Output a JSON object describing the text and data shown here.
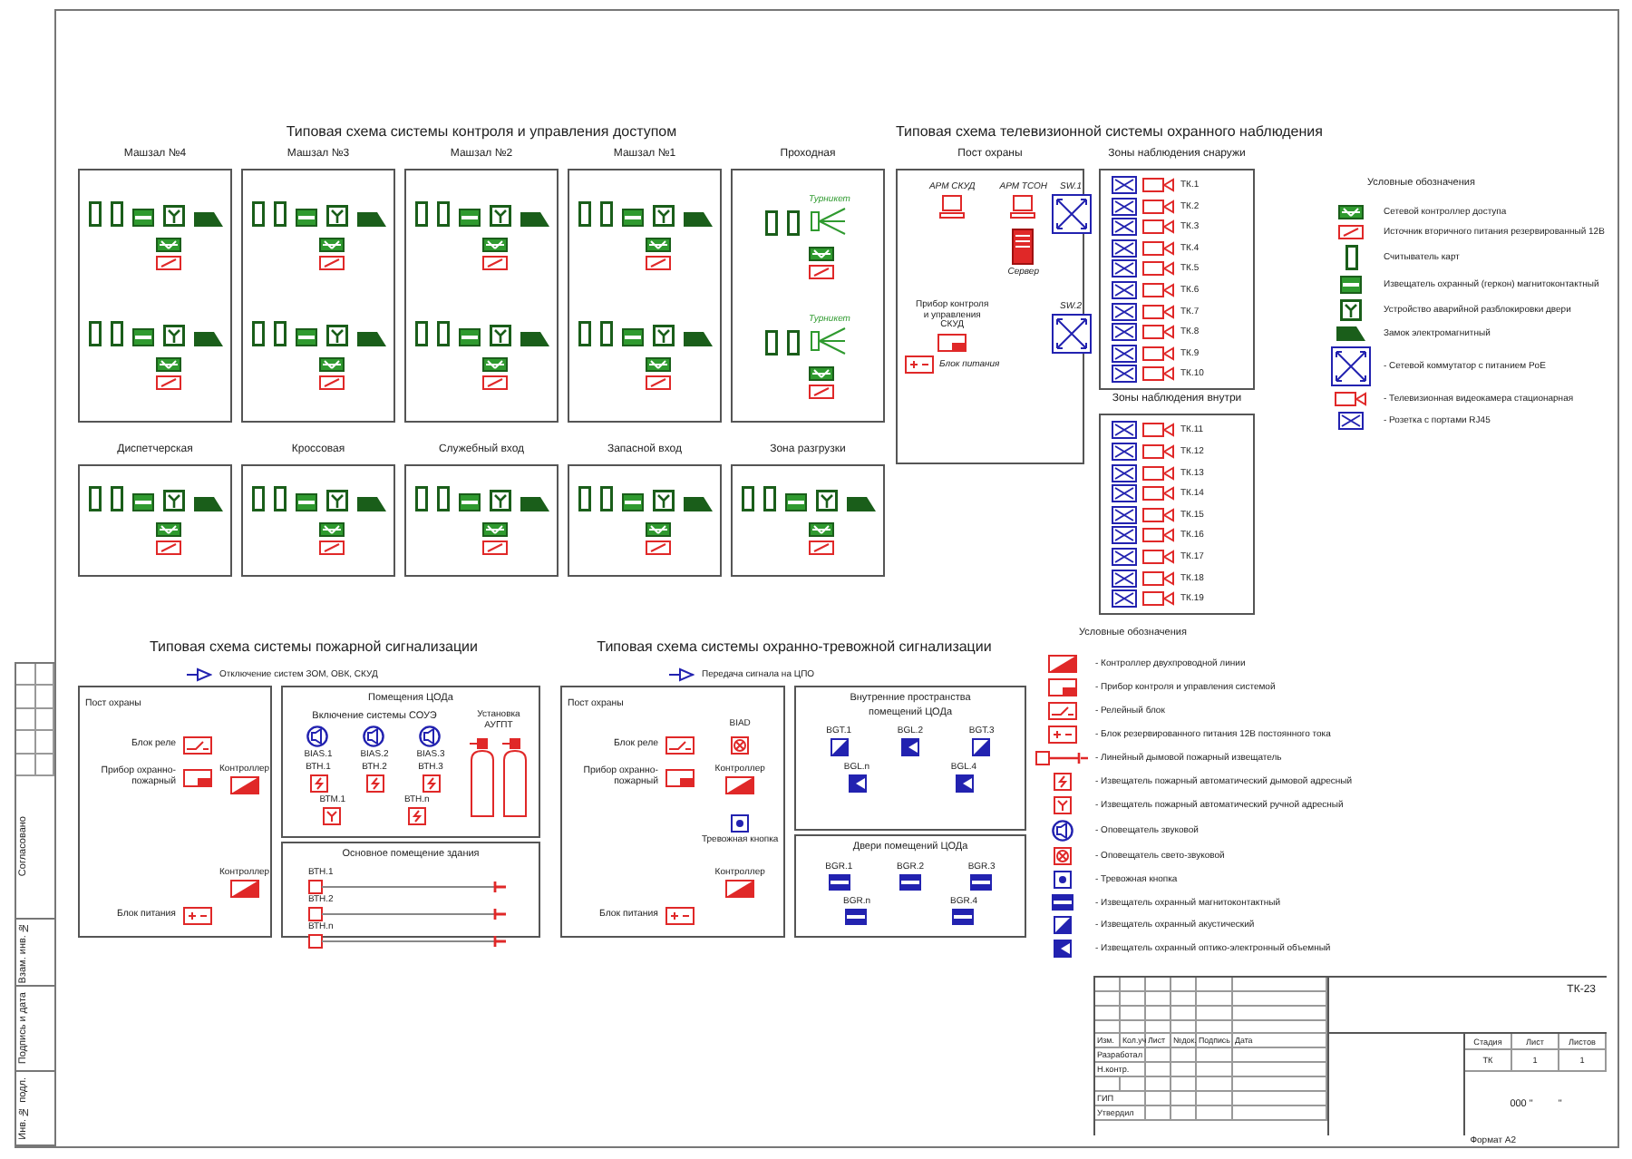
{
  "access_control": {
    "title": "Типовая схема системы контроля и управления доступом",
    "zone_rows": [
      [
        {
          "name": "Машзал №4",
          "units": [
            {
              "devices": [
                {
                  "kind": "reader"
                },
                {
                  "kind": "reader"
                },
                {
                  "kind": "contact"
                },
                {
                  "kind": "release"
                },
                {
                  "kind": "lock"
                }
              ]
            },
            {
              "devices": [
                {
                  "kind": "reader"
                },
                {
                  "kind": "reader"
                },
                {
                  "kind": "contact"
                },
                {
                  "kind": "release"
                },
                {
                  "kind": "lock"
                }
              ]
            }
          ]
        },
        {
          "name": "Машзал №3",
          "units": [
            {
              "devices": [
                {
                  "kind": "reader"
                },
                {
                  "kind": "reader"
                },
                {
                  "kind": "contact"
                },
                {
                  "kind": "release"
                },
                {
                  "kind": "lock"
                }
              ]
            },
            {
              "devices": [
                {
                  "kind": "reader"
                },
                {
                  "kind": "reader"
                },
                {
                  "kind": "contact"
                },
                {
                  "kind": "release"
                },
                {
                  "kind": "lock"
                }
              ]
            }
          ]
        },
        {
          "name": "Машзал №2",
          "units": [
            {
              "devices": [
                {
                  "kind": "reader"
                },
                {
                  "kind": "reader"
                },
                {
                  "kind": "contact"
                },
                {
                  "kind": "release"
                },
                {
                  "kind": "lock"
                }
              ]
            },
            {
              "devices": [
                {
                  "kind": "reader"
                },
                {
                  "kind": "reader"
                },
                {
                  "kind": "contact"
                },
                {
                  "kind": "release"
                },
                {
                  "kind": "lock"
                }
              ]
            }
          ]
        },
        {
          "name": "Машзал №1",
          "units": [
            {
              "devices": [
                {
                  "kind": "reader"
                },
                {
                  "kind": "reader"
                },
                {
                  "kind": "contact"
                },
                {
                  "kind": "release"
                },
                {
                  "kind": "lock"
                }
              ]
            },
            {
              "devices": [
                {
                  "kind": "reader"
                },
                {
                  "kind": "reader"
                },
                {
                  "kind": "contact"
                },
                {
                  "kind": "release"
                },
                {
                  "kind": "lock"
                }
              ]
            }
          ]
        },
        {
          "name": "Проходная",
          "units": [
            {
              "devices": [
                {
                  "kind": "reader"
                },
                {
                  "kind": "reader"
                },
                {
                  "kind": "turnstile",
                  "label": "Турникет"
                }
              ]
            },
            {
              "devices": [
                {
                  "kind": "reader"
                },
                {
                  "kind": "reader"
                },
                {
                  "kind": "turnstile",
                  "label": "Турникет"
                }
              ]
            }
          ]
        }
      ],
      [
        {
          "name": "Диспетчерская",
          "units": [
            {
              "devices": [
                {
                  "kind": "reader"
                },
                {
                  "kind": "reader"
                },
                {
                  "kind": "contact"
                },
                {
                  "kind": "release"
                },
                {
                  "kind": "lock"
                }
              ]
            }
          ]
        },
        {
          "name": "Кроссовая",
          "units": [
            {
              "devices": [
                {
                  "kind": "reader"
                },
                {
                  "kind": "reader"
                },
                {
                  "kind": "contact"
                },
                {
                  "kind": "release"
                },
                {
                  "kind": "lock"
                }
              ]
            }
          ]
        },
        {
          "name": "Служебный вход",
          "units": [
            {
              "devices": [
                {
                  "kind": "reader"
                },
                {
                  "kind": "reader"
                },
                {
                  "kind": "contact"
                },
                {
                  "kind": "release"
                },
                {
                  "kind": "lock"
                }
              ]
            }
          ]
        },
        {
          "name": "Запасной вход",
          "units": [
            {
              "devices": [
                {
                  "kind": "reader"
                },
                {
                  "kind": "reader"
                },
                {
                  "kind": "contact"
                },
                {
                  "kind": "release"
                },
                {
                  "kind": "lock"
                }
              ]
            }
          ]
        },
        {
          "name": "Зона разгрузки",
          "units": [
            {
              "devices": [
                {
                  "kind": "reader"
                },
                {
                  "kind": "reader"
                },
                {
                  "kind": "contact"
                },
                {
                  "kind": "release"
                },
                {
                  "kind": "lock"
                }
              ]
            }
          ]
        }
      ]
    ]
  },
  "cctv": {
    "title": "Типовая схема телевизионной системы охранного наблюдения",
    "post": {
      "name": "Пост охраны",
      "workstations": [
        "АРМ СКУД",
        "АРМ ТСОН"
      ],
      "server": "Сервер",
      "switches": [
        "SW.1",
        "SW.2"
      ],
      "panel": "Прибор контроля и управления СКУД",
      "power": "Блок питания"
    },
    "zone_groups": [
      {
        "name": "Зоны наблюдения снаружи",
        "cameras": [
          "ТК.1",
          "ТК.2",
          "ТК.3",
          "ТК.4",
          "ТК.5",
          "ТК.6",
          "ТК.7",
          "ТК.8",
          "ТК.9",
          "ТК.10"
        ]
      },
      {
        "name": "Зоны наблюдения внутри",
        "cameras": [
          "ТК.11",
          "ТК.12",
          "ТК.13",
          "ТК.14",
          "ТК.15",
          "ТК.16",
          "ТК.17",
          "ТК.18",
          "ТК.19"
        ]
      }
    ]
  },
  "top_legend": {
    "title": "Условные обозначения",
    "items": [
      {
        "kind": "access_controller",
        "label": "Сетевой контроллер доступа"
      },
      {
        "kind": "access_psu",
        "label": "Источник вторичного питания резервированный 12В"
      },
      {
        "kind": "reader",
        "label": "Считыватель карт"
      },
      {
        "kind": "contact",
        "label": "Извещатель охранный (геркон) магнитоконтактный"
      },
      {
        "kind": "release",
        "label": "Устройство аварийной разблокировки двери"
      },
      {
        "kind": "lock",
        "label": "Замок электромагнитный"
      },
      {
        "kind": "switch",
        "label": "- Сетевой коммутатор с питанием PoE"
      },
      {
        "kind": "camera",
        "label": "- Телевизионная видеокамера стационарная"
      },
      {
        "kind": "socket",
        "label": "- Розетка с портами RJ45"
      }
    ]
  },
  "fire": {
    "title": "Типовая схема системы пожарной сигнализации",
    "output": "Отключение систем ЗОМ, ОВК, СКУД",
    "post": {
      "name": "Пост охраны",
      "relay": "Блок реле",
      "panel": "Прибор охранно-пожарный",
      "power": "Блок питания",
      "controllers": [
        "Контроллер",
        "Контроллер"
      ]
    },
    "rooms": {
      "name": "Помещения ЦОДа",
      "soue": "Включение системы СОУЭ",
      "sounders": [
        "BIAS.1",
        "BIAS.2",
        "BIAS.3"
      ],
      "detector_rows": [
        [
          {
            "kind": "smoke",
            "label": "ВТН.1"
          },
          {
            "kind": "smoke",
            "label": "ВТН.2"
          },
          {
            "kind": "smoke",
            "label": "ВТН.3"
          }
        ],
        [
          {
            "kind": "manual",
            "label": "ВТМ.1"
          },
          {
            "kind": "smoke",
            "label": "ВТН.n"
          }
        ]
      ],
      "extinguishing": "Установка АУГПТ"
    },
    "hall": {
      "name": "Основное помещение здания",
      "beams": [
        "ВТН.1",
        "ВТН.2",
        "ВТН.n"
      ]
    }
  },
  "security": {
    "title": "Типовая схема системы охранно-тревожной сигнализации",
    "output": "Передача сигнала на ЦПО",
    "post": {
      "name": "Пост охраны",
      "strobe": "BIAD",
      "relay": "Блок реле",
      "panel": "Прибор охранно-пожарный",
      "power": "Блок питания",
      "controllers": [
        "Контроллер",
        "Контроллер"
      ],
      "button": "Тревожная кнопка"
    },
    "areas": [
      {
        "name": "Внутренние пространства помещений ЦОДа",
        "rows": [
          [
            {
              "kind": "acoustic",
              "label": "BGT.1"
            },
            {
              "kind": "optical",
              "label": "BGL.2"
            },
            {
              "kind": "acoustic",
              "label": "BGT.3"
            }
          ],
          [
            {
              "kind": "optical",
              "label": "BGL.n"
            },
            {
              "kind": "optical",
              "label": "BGL.4"
            }
          ]
        ]
      },
      {
        "name": "Двери помещений ЦОДа",
        "rows": [
          [
            {
              "kind": "magnetic",
              "label": "BGR.1"
            },
            {
              "kind": "magnetic",
              "label": "BGR.2"
            },
            {
              "kind": "magnetic",
              "label": "BGR.3"
            }
          ],
          [
            {
              "kind": "magnetic",
              "label": "BGR.n"
            },
            {
              "kind": "magnetic",
              "label": "BGR.4"
            }
          ]
        ]
      }
    ]
  },
  "bottom_legend": {
    "title": "Условные обозначения",
    "items": [
      {
        "kind": "loop_controller",
        "label": "- Контроллер двухпроводной линии"
      },
      {
        "kind": "panel",
        "label": "- Прибор контроля и управления системой"
      },
      {
        "kind": "relay",
        "label": "- Релейный блок"
      },
      {
        "kind": "power_block",
        "label": "- Блок резервированного питания 12В постоянного тока"
      },
      {
        "kind": "linear",
        "label": "- Линейный дымовой пожарный извещатель"
      },
      {
        "kind": "smoke",
        "label": "- Извещатель пожарный автоматический дымовой адресный"
      },
      {
        "kind": "manual",
        "label": "- Извещатель пожарный автоматический ручной адресный"
      },
      {
        "kind": "sounder",
        "label": "- Оповещатель звуковой"
      },
      {
        "kind": "strobe",
        "label": "- Оповещатель свето-звуковой"
      },
      {
        "kind": "alarm_button",
        "label": "- Тревожная кнопка"
      },
      {
        "kind": "magnetic",
        "label": "- Извещатель охранный магнитоконтактный"
      },
      {
        "kind": "acoustic",
        "label": "- Извещатель охранный акустический"
      },
      {
        "kind": "optical",
        "label": "- Извещатель охранный оптико-электронный объемный"
      }
    ]
  },
  "side_stamp": [
    "Согласовано",
    "Взам. инв. №",
    "Подпись и дата",
    "Инв. № подл."
  ],
  "title_block": {
    "code": "ТК-23",
    "headers": [
      "Изм.",
      "Кол.уч",
      "Лист",
      "№док.",
      "Подпись",
      "Дата"
    ],
    "roles": [
      "Разработал",
      "Н.контр.",
      "ГИП",
      "Утвердил"
    ],
    "stage_headers": [
      "Стадия",
      "Лист",
      "Листов"
    ],
    "stage_values": [
      "ТК",
      "1",
      "1"
    ],
    "doc_number": [
      "000 \"",
      "\""
    ],
    "format": "Формат А2"
  }
}
